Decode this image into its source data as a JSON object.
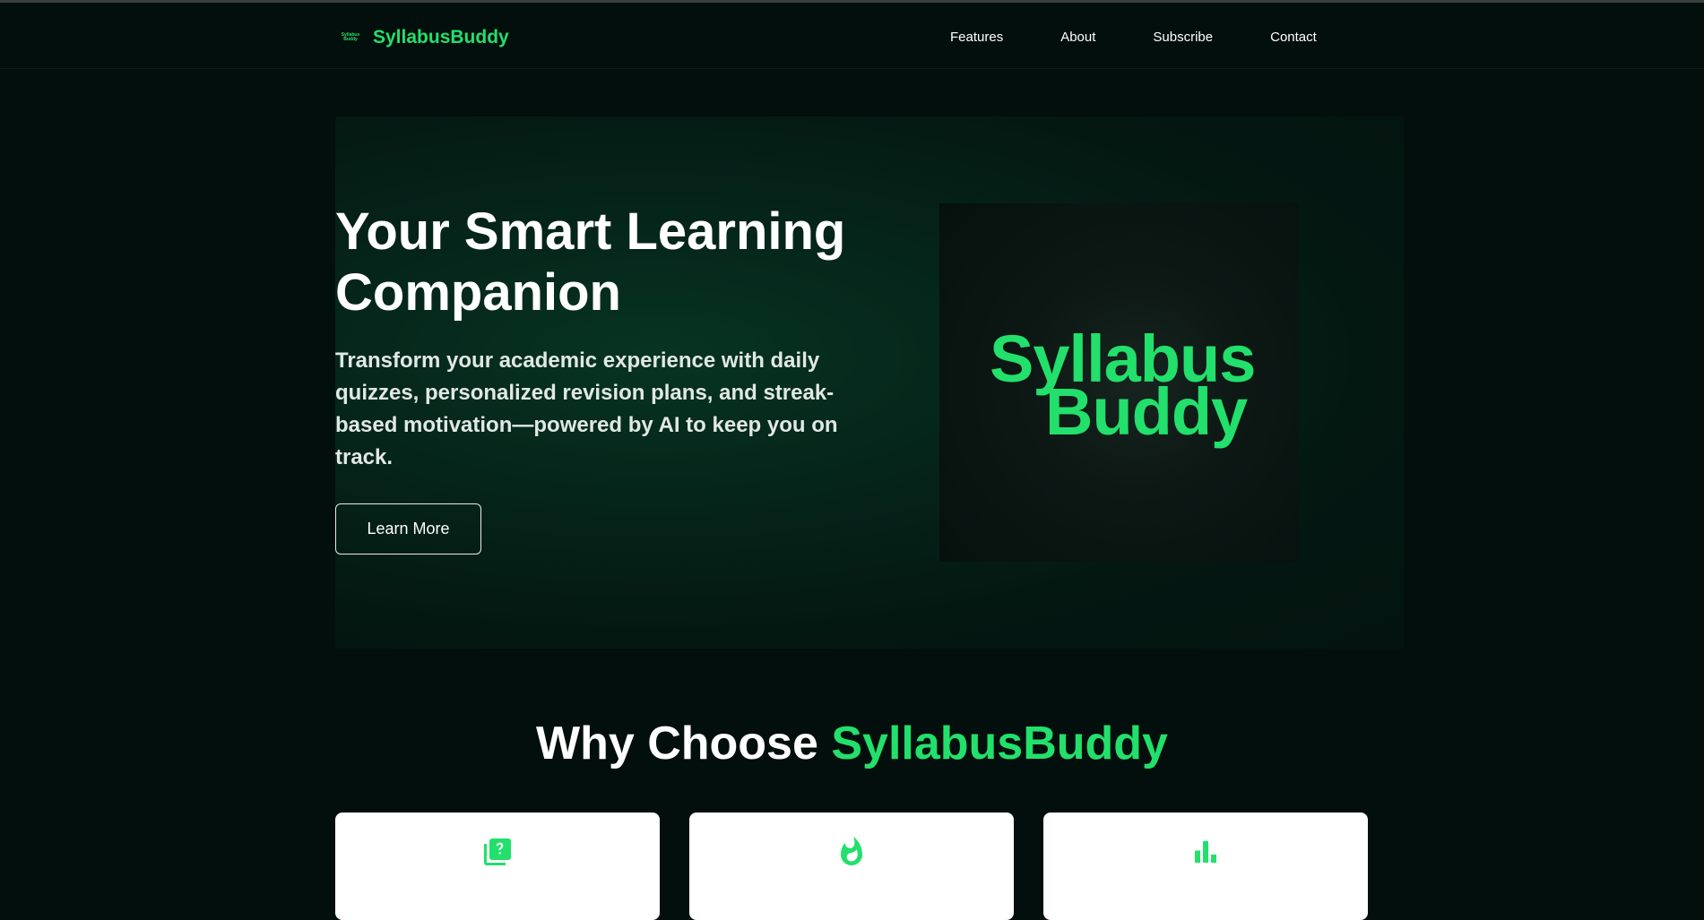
{
  "nav": {
    "logo_line1": "Syllabus",
    "logo_line2": "Buddy",
    "brand": "SyllabusBuddy",
    "links": [
      "Features",
      "About",
      "Subscribe",
      "Contact"
    ]
  },
  "hero": {
    "title": "Your Smart Learning Companion",
    "subtitle": "Transform your academic experience with daily quizzes, personalized revision plans, and streak-based motivation—powered by AI to keep you on track.",
    "button": "Learn More",
    "logo_line1": "Syllabus",
    "logo_line2": "Buddy"
  },
  "why": {
    "title_prefix": "Why Choose ",
    "title_accent": "SyllabusBuddy"
  },
  "cards": [
    {
      "icon": "quiz-icon"
    },
    {
      "icon": "fire-icon"
    },
    {
      "icon": "bar-chart-icon"
    }
  ],
  "colors": {
    "background": "#030f0c",
    "accent": "#22e06b",
    "card": "#ffffff"
  }
}
